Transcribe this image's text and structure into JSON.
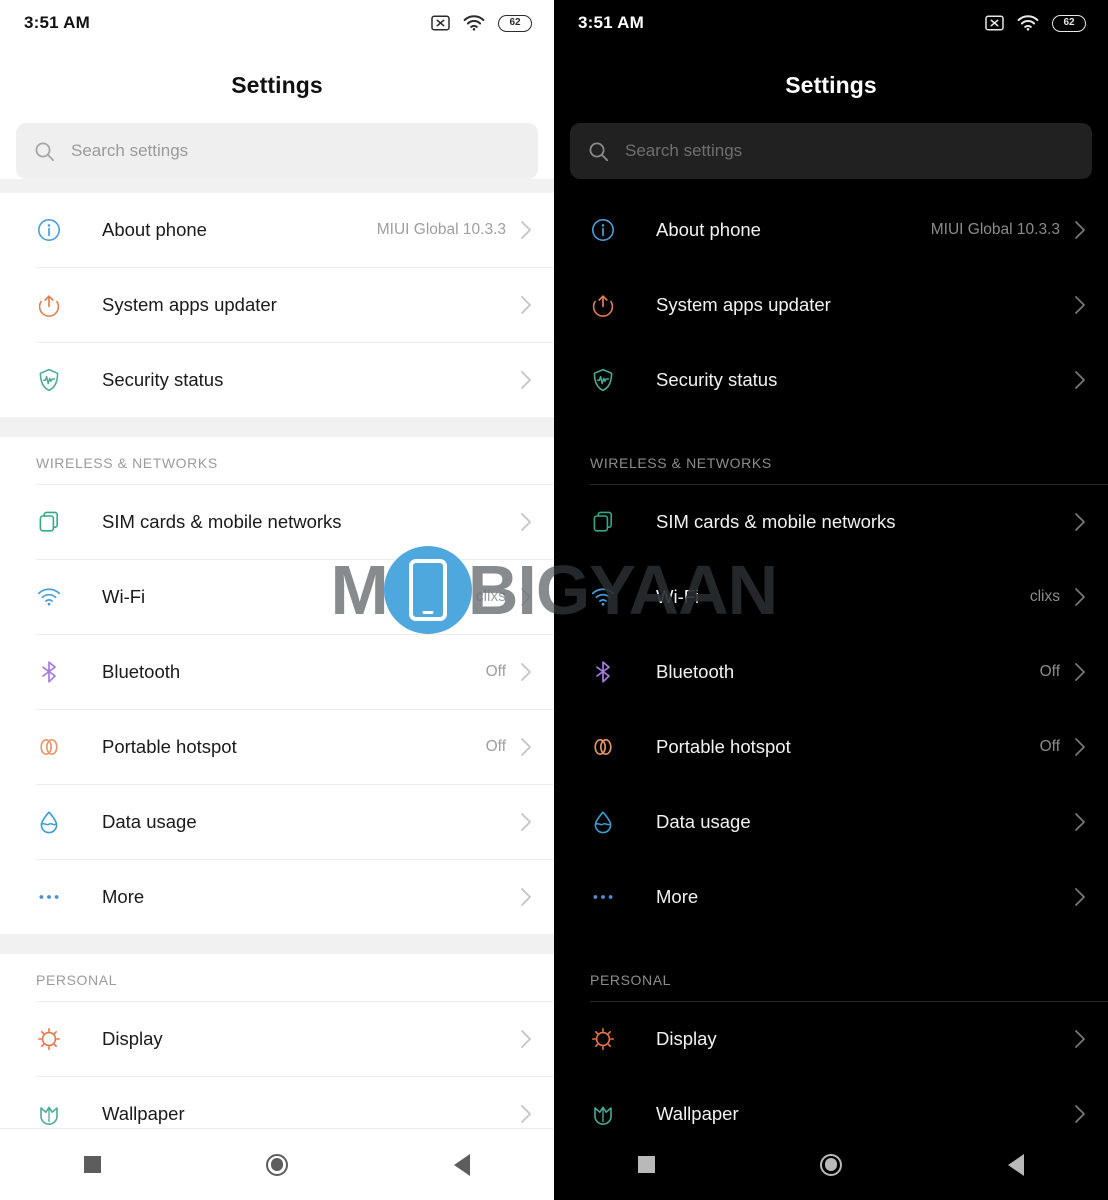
{
  "status_bar": {
    "time": "3:51 AM",
    "icons": [
      "mute-box-icon",
      "wifi-icon",
      "battery-icon"
    ],
    "battery_level": "62"
  },
  "header": {
    "title": "Settings"
  },
  "search": {
    "placeholder": "Search settings",
    "value": "",
    "icon": "search-icon"
  },
  "sections": [
    {
      "header": "",
      "items": [
        {
          "label": "About phone",
          "value": "MIUI Global 10.3.3",
          "icon": "info-circle-icon",
          "color": "#4a9fd8"
        },
        {
          "label": "System apps updater",
          "value": "",
          "icon": "update-arrow-icon",
          "color": "#e08050"
        },
        {
          "label": "Security status",
          "value": "",
          "icon": "shield-pulse-icon",
          "color": "#4cab96"
        }
      ]
    },
    {
      "header": "WIRELESS & NETWORKS",
      "items": [
        {
          "label": "SIM cards & mobile networks",
          "value": "",
          "icon": "sim-cards-icon",
          "color": "#35a888"
        },
        {
          "label": "Wi-Fi",
          "value": "clixs",
          "icon": "wifi-icon",
          "color": "#4a9fd8"
        },
        {
          "label": "Bluetooth",
          "value": "Off",
          "icon": "bluetooth-icon",
          "color": "#a77ce0"
        },
        {
          "label": "Portable hotspot",
          "value": "Off",
          "icon": "hotspot-rings-icon",
          "color": "#e8956a"
        },
        {
          "label": "Data usage",
          "value": "",
          "icon": "water-drop-icon",
          "color": "#3c9dd0"
        },
        {
          "label": "More",
          "value": "",
          "icon": "more-dots-icon",
          "color": "#4a8fd8"
        }
      ]
    },
    {
      "header": "PERSONAL",
      "items": [
        {
          "label": "Display",
          "value": "",
          "icon": "sun-icon",
          "color": "#e8764a"
        },
        {
          "label": "Wallpaper",
          "value": "",
          "icon": "tulip-icon",
          "color": "#4cab96"
        }
      ]
    }
  ],
  "nav_bar": {
    "buttons": [
      {
        "name": "recents-button",
        "icon": "square-icon"
      },
      {
        "name": "home-button",
        "icon": "circle-icon"
      },
      {
        "name": "back-button",
        "icon": "triangle-left-icon"
      }
    ]
  },
  "watermark": {
    "text_before": "M",
    "text_after": "BIGYAAN",
    "logo": "phone-in-circle-logo"
  },
  "panels": [
    {
      "theme": "light",
      "name": "light-theme-settings"
    },
    {
      "theme": "dark",
      "name": "dark-theme-settings"
    }
  ]
}
